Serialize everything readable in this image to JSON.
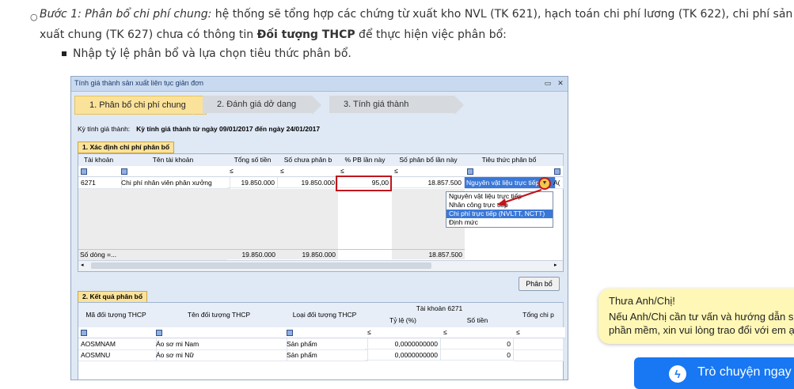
{
  "doc": {
    "step_label": "Bước 1: Phân bổ chi phí chung:",
    "line1_rest": " hệ thống sẽ tổng hợp các chứng từ xuất kho NVL (TK 621), hạch toán chi phí lương (TK 622), chi phí sản",
    "line2_start": "xuất chung (TK 627) chưa có thông tin ",
    "line2_bold": "Đối tượng THCP",
    "line2_end": " để thực hiện việc phân bổ:",
    "sub_bullet": "Nhập tỷ lệ phân bổ và lựa chọn tiêu thức phân bổ."
  },
  "window": {
    "title": "Tính giá thành sản xuất liên tục giản đơn",
    "steps": [
      "1. Phân bổ chi phí chung",
      "2. Đánh giá dở dang",
      "3. Tính giá thành"
    ],
    "period_label": "Kỳ tính giá thành:",
    "period_value": "Kỳ tính giá thành từ ngày 09/01/2017 đến ngày 24/01/2017",
    "section1_title": "1. Xác định chi phí phân bổ",
    "section2_title": "2. Kết quả phân bổ",
    "allocate_button": "Phân bổ"
  },
  "grid1": {
    "headers": [
      "Tài khoản",
      "Tên tài khoản",
      "Tổng số tiền",
      "Số chưa phân b",
      "% PB lần này",
      "Số phân bổ lần này",
      "Tiêu thức phân bổ"
    ],
    "filter_ops": [
      "≤",
      "≤",
      "≤",
      "≤"
    ],
    "row": {
      "account": "6271",
      "name": "Chi phí nhân viên phân xưởng",
      "total": "19.850.000",
      "unallocated": "19.850.000",
      "percent": "95,00",
      "allocated": "18.857.500",
      "criterion": "Nguyên vật liệu trực tiếp",
      "extra": "A("
    },
    "footer": {
      "label": "Số dòng =...",
      "total": "19.850.000",
      "unallocated": "19.850.000",
      "allocated": "18.857.500"
    }
  },
  "dropdown": {
    "options": [
      "Nguyên vật liệu trực tiếp",
      "Nhân công trực tiếp",
      "Chi phí trực tiếp (NVLTT, NCTT)",
      "Định mức"
    ],
    "selected_index": 2
  },
  "grid2": {
    "headers": [
      "Mã đối tượng THCP",
      "Tên đối tượng THCP",
      "Loại đối tượng THCP",
      "Tài khoản 6271",
      "Tỷ lệ (%)",
      "Số tiền",
      "Tổng chi p"
    ],
    "filter_ops": [
      "≤",
      "≤",
      "≤"
    ],
    "rows": [
      {
        "code": "AOSMNAM",
        "name": "Áo sơ mi Nam",
        "type": "Sản phẩm",
        "rate": "0,0000000000",
        "amount": "0"
      },
      {
        "code": "AOSMNU",
        "name": "Áo sơ mi Nữ",
        "type": "Sản phẩm",
        "rate": "0,0000000000",
        "amount": "0"
      }
    ]
  },
  "chat": {
    "greeting": "Thưa Anh/Chị!",
    "line2": "Nếu Anh/Chị cần tư vấn và hướng dẫn sử",
    "line3": "phần mềm, xin vui lòng trao đổi với em ạ",
    "button": "Trò chuyện ngay",
    "button_color": "#1877f2"
  }
}
